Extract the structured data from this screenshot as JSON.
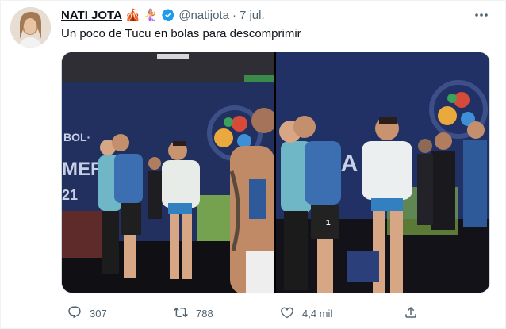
{
  "tweet": {
    "author_name": "NATI JOTA",
    "emojis": [
      "🎪",
      "🧜‍♀️"
    ],
    "handle": "@natijota",
    "separator": "·",
    "date": "7 jul.",
    "text": "Un poco de Tucu en bolas para descomprimir"
  },
  "media": {
    "left_banner_text": "BOL·\nMERIC\n21",
    "right_banner_text": "CA",
    "shirt_number": "1"
  },
  "actions": {
    "reply_count": "307",
    "retweet_count": "788",
    "like_count": "4,4 mil"
  },
  "icons": {
    "reply": "reply-icon",
    "retweet": "retweet-icon",
    "like": "heart-icon",
    "share": "share-icon",
    "verified": "verified-badge-icon",
    "more": "more-options-icon"
  },
  "colors": {
    "text_primary": "#0f1419",
    "text_secondary": "#536471",
    "verified_blue": "#1d9bf0",
    "banner_navy": "#1e2a5a"
  }
}
